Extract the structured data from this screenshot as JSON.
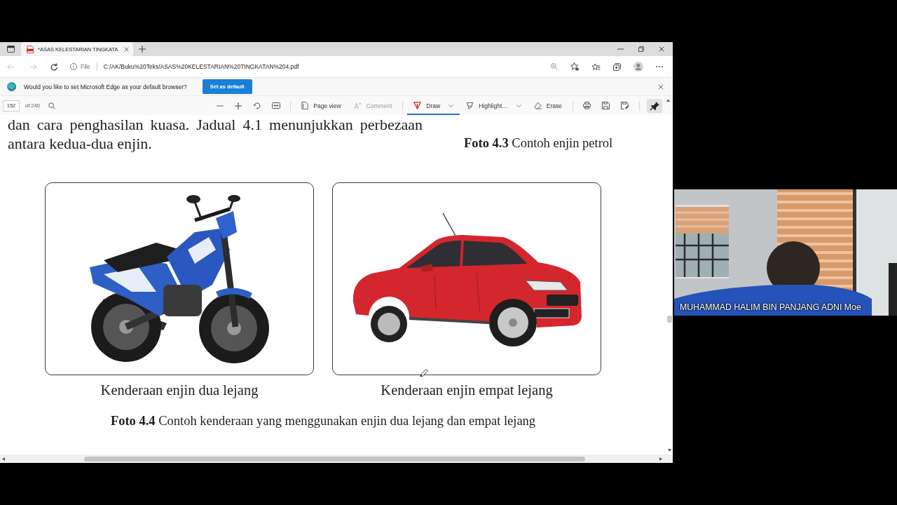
{
  "browser": {
    "tabs": [
      {
        "title": "*ASAS KELESTARIAN TINGKATA",
        "selected": true
      }
    ],
    "address_bar": {
      "scheme": "File",
      "url": "C:/AK/Buku%20Teks/ASAS%20KELESTARIAN%20TINGKATAN%204.pdf"
    },
    "infobar": {
      "message": "Would you like to set Microsoft Edge as your default browser?",
      "button": "Set as default"
    }
  },
  "pdf_toolbar": {
    "page": "152",
    "page_count": "of 240",
    "tools": [
      {
        "kind": "button",
        "label": "Page view",
        "selected": false,
        "disabled": false
      },
      {
        "kind": "button",
        "label": "Comment",
        "selected": false,
        "disabled": true
      },
      {
        "kind": "dropdown",
        "label": "Draw",
        "selected": true,
        "disabled": false
      },
      {
        "kind": "dropdown",
        "label": "Highlight…",
        "selected": false,
        "disabled": false
      },
      {
        "kind": "button",
        "label": "Erase",
        "selected": false,
        "disabled": false
      }
    ]
  },
  "document": {
    "paragraph": "dan cara penghasilan kuasa. Jadual 4.1 menunjukkan perbezaan antara kedua-dua enjin.",
    "side_caption": "**Foto 4.3** Contoh enjin petrol",
    "photos": [
      {
        "kind": "motorcycle",
        "caption": "Kenderaan enjin dua lejang"
      },
      {
        "kind": "car",
        "caption": "Kenderaan enjin empat lejang"
      }
    ],
    "figure_caption": "**Foto 4.4** Contoh kenderaan yang menggunakan enjin dua lejang dan empat lejang"
  },
  "video": {
    "participant": "MUHAMMAD HALIM BIN PANJANG ADNI Moe"
  }
}
